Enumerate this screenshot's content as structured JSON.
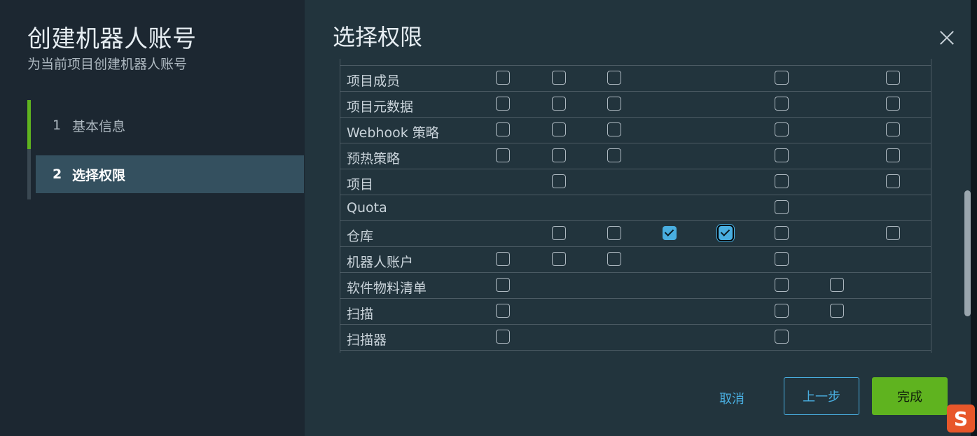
{
  "wizard": {
    "title": "创建机器人账号",
    "subtitle": "为当前项目创建机器人账号",
    "steps": [
      {
        "num": "1",
        "label": "基本信息",
        "state": "done"
      },
      {
        "num": "2",
        "label": "选择权限",
        "state": "active"
      }
    ]
  },
  "panel": {
    "title": "选择权限",
    "close_icon": "close-icon"
  },
  "permissions": {
    "rows": [
      {
        "label": "",
        "checkboxes": [
          0,
          1,
          2,
          5,
          7
        ],
        "checked": [],
        "partial": true
      },
      {
        "label": "项目成员",
        "checkboxes": [
          0,
          1,
          2,
          5,
          7
        ],
        "checked": []
      },
      {
        "label": "项目元数据",
        "checkboxes": [
          0,
          1,
          2,
          5,
          7
        ],
        "checked": []
      },
      {
        "label": "Webhook 策略",
        "checkboxes": [
          0,
          1,
          2,
          5,
          7
        ],
        "checked": []
      },
      {
        "label": "预热策略",
        "checkboxes": [
          0,
          1,
          2,
          5,
          7
        ],
        "checked": []
      },
      {
        "label": "项目",
        "checkboxes": [
          1,
          5,
          7
        ],
        "checked": []
      },
      {
        "label": "Quota",
        "checkboxes": [
          5
        ],
        "checked": []
      },
      {
        "label": "仓库",
        "checkboxes": [
          1,
          2,
          3,
          4,
          5,
          7
        ],
        "checked": [
          3,
          4
        ],
        "focused": [
          4
        ]
      },
      {
        "label": "机器人账户",
        "checkboxes": [
          0,
          1,
          2,
          5
        ],
        "checked": []
      },
      {
        "label": "软件物料清单",
        "checkboxes": [
          0,
          5,
          6
        ],
        "checked": []
      },
      {
        "label": "扫描",
        "checkboxes": [
          0,
          5,
          6
        ],
        "checked": []
      },
      {
        "label": "扫描器",
        "checkboxes": [
          0,
          5
        ],
        "checked": []
      },
      {
        "label": "",
        "checkboxes": [
          0,
          1,
          2
        ],
        "checked": []
      }
    ]
  },
  "footer": {
    "cancel_label": "取消",
    "back_label": "上一步",
    "finish_label": "完成"
  },
  "colors": {
    "accent_blue": "#49aee0",
    "success_green": "#5fb31f"
  },
  "ime": {
    "glyph": "S"
  }
}
